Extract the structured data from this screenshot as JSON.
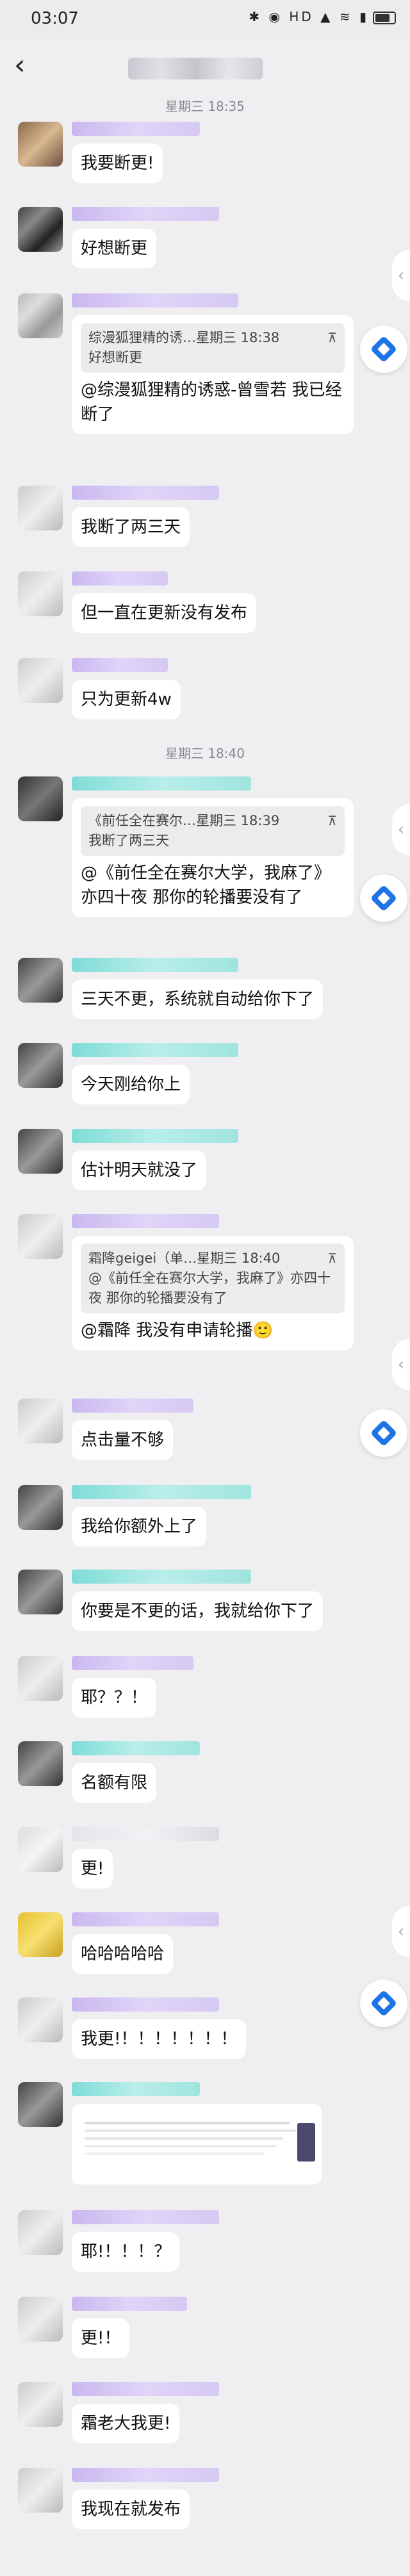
{
  "status_bar": {
    "time": "03:07",
    "icons": "✱ ◉ HD ▲ ≋ ▮"
  },
  "header": {
    "back_icon": "chevron-left-icon",
    "title": ""
  },
  "timestamps": [
    "星期三 18:35",
    "星期三 18:40"
  ],
  "messages": [
    {
      "text": "我要断更!"
    },
    {
      "text": "好想断更"
    },
    {
      "quote_author": "综漫狐狸精的诱…星期三 18:38",
      "quote_text": "好想断更",
      "text": "@综漫狐狸精的诱惑-曾雪若 我已经断了"
    },
    {
      "text": "我断了两三天"
    },
    {
      "text": "但一直在更新没有发布"
    },
    {
      "text": "只为更新4w"
    },
    {
      "quote_author": "《前任全在赛尔…星期三 18:39",
      "quote_text": "我断了两三天",
      "text": "@《前任全在赛尔大学，我麻了》亦四十夜 那你的轮播要没有了"
    },
    {
      "text": "三天不更，系统就自动给你下了"
    },
    {
      "text": "今天刚给你上"
    },
    {
      "text": "估计明天就没了"
    },
    {
      "quote_author": "霜降geigei（单…星期三 18:40",
      "quote_text": "@《前任全在赛尔大学，我麻了》亦四十夜 那你的轮播要没有了",
      "text": "@霜降 我没有申请轮播🙂"
    },
    {
      "text": "点击量不够"
    },
    {
      "text": "我给你额外上了"
    },
    {
      "text": "你要是不更的话，我就给你下了"
    },
    {
      "text": "耶？？！"
    },
    {
      "text": "名额有限"
    },
    {
      "text": "更!"
    },
    {
      "text": "哈哈哈哈哈"
    },
    {
      "text": "我更!！！！！！！！"
    },
    {
      "text": "耶!！！！？"
    },
    {
      "text": "更!！"
    },
    {
      "text": "霜老大我更!"
    },
    {
      "text": "我现在就发布"
    }
  ],
  "colors": {
    "background": "#efeff2",
    "bubble": "#ffffff",
    "accent": "#1e74e6"
  }
}
